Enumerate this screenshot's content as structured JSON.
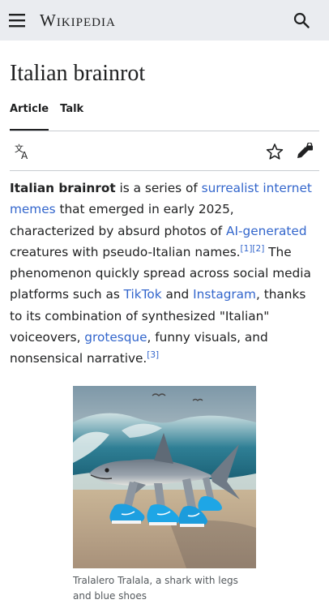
{
  "header": {
    "logo_text": "Wikipedia",
    "menu_icon": "hamburger-menu-icon",
    "search_icon": "search-icon",
    "background": "#eaecf0"
  },
  "page": {
    "title": "Italian brainrot",
    "tabs": [
      {
        "label": "Article",
        "active": true
      },
      {
        "label": "Talk",
        "active": false
      }
    ],
    "actions": {
      "translate_icon": "language-translate-icon",
      "watch_icon": "star-icon",
      "edit_icon": "edit-lock-icon"
    }
  },
  "lead": {
    "bold_term": "Italian brainrot",
    "t1": " is a series of ",
    "link1": "surrealist internet memes",
    "t2": " that emerged in early 2025, characterized by absurd photos of ",
    "link2": "AI-generated",
    "t3": " creatures with pseudo-Italian names.",
    "ref1": "[1]",
    "ref2": "[2]",
    "t4": " The phenomenon quickly spread across social media platforms such as ",
    "link3": "TikTok",
    "t5": " and ",
    "link4": "Instagram",
    "t6": ", thanks to its combination of synthesized \"Italian\" voiceovers, ",
    "link5": "grotesque",
    "t7": ", funny visuals, and nonsensical narrative.",
    "ref3": "[3]",
    "link_color": "#3366cc"
  },
  "figure": {
    "caption": "Tralalero Tralala, a shark with legs and blue shoes"
  }
}
